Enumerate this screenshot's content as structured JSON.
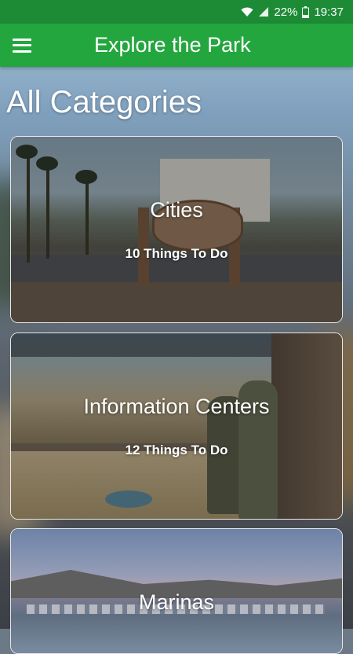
{
  "status_bar": {
    "battery": "22%",
    "time": "19:37",
    "icons": [
      "wifi-icon",
      "signal-icon",
      "battery-icon"
    ]
  },
  "app_bar": {
    "title": "Explore the Park",
    "menu_icon": "hamburger-menu-icon"
  },
  "page": {
    "heading": "All Categories"
  },
  "categories": [
    {
      "title": "Cities",
      "count_label": "10 Things To Do"
    },
    {
      "title": "Information Centers",
      "count_label": "12 Things To Do"
    },
    {
      "title": "Marinas",
      "count_label": ""
    }
  ],
  "colors": {
    "status_bar": "#1d8b35",
    "app_bar": "#24a63f",
    "text": "#ffffff"
  }
}
